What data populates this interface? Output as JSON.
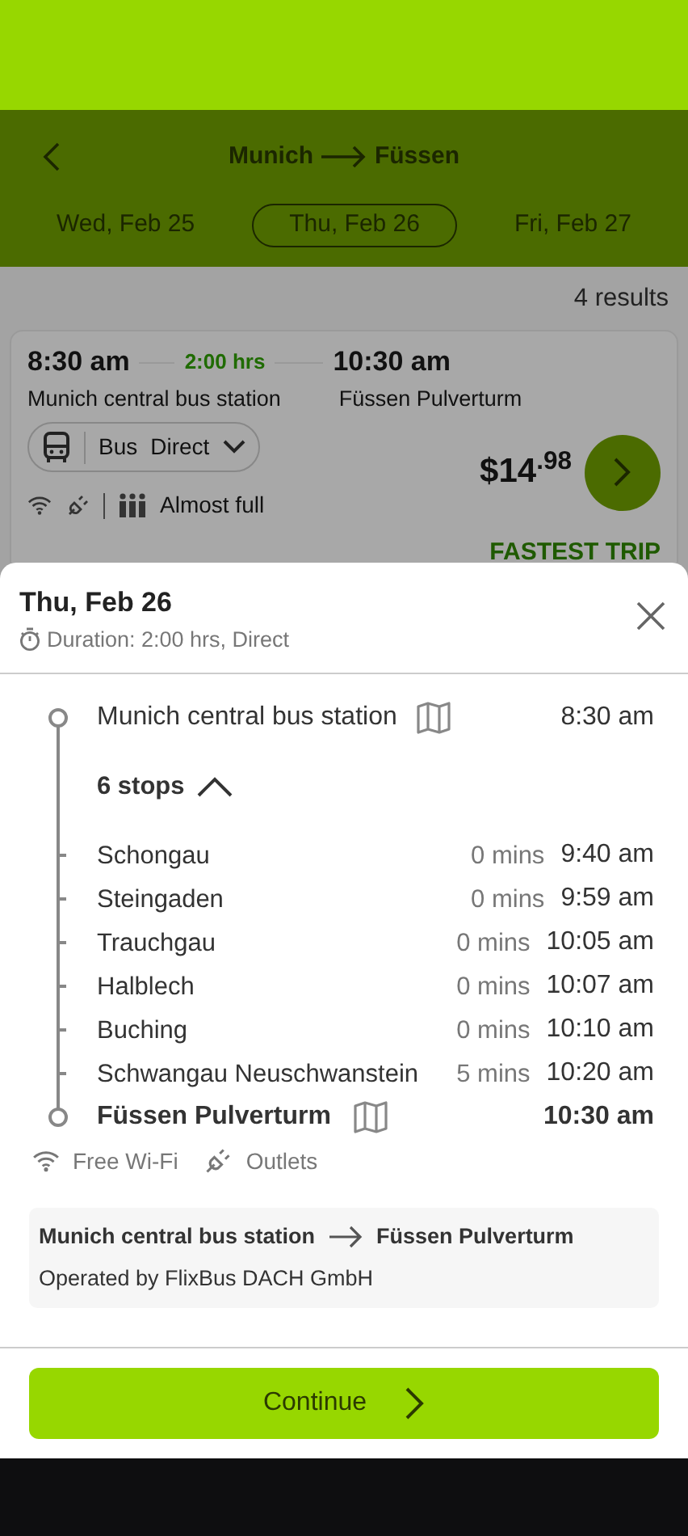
{
  "header": {
    "from": "Munich",
    "to": "Füssen"
  },
  "date_tabs": [
    {
      "label": "Wed, Feb 25",
      "selected": false
    },
    {
      "label": "Thu, Feb 26",
      "selected": true
    },
    {
      "label": "Fri, Feb 27",
      "selected": false
    }
  ],
  "results_count": "4 results",
  "trip_card": {
    "departure_time": "8:30 am",
    "duration": "2:00 hrs",
    "arrival_time": "10:30 am",
    "from": "Munich central bus station",
    "to": "Füssen Pulverturm",
    "mode": "Bus",
    "type": "Direct",
    "price": "$14$^{.98}$",
    "occupancy": "Almost full",
    "badge": "FASTEST TRIP"
  },
  "sheet": {
    "date": "Thu, Feb 26",
    "duration": "Duration: 2:00 hrs, Direct",
    "departure": {
      "name": "Munich central bus station",
      "time": "8:30 am"
    },
    "stops_toggle": {
      "label": "6 stops",
      "expanded": true
    },
    "stops": [
      {
        "name": "Schongau",
        "wait": "0 mins",
        "time": "9:40 am"
      },
      {
        "name": "Steingaden",
        "wait": "0 mins",
        "time": "9:59 am"
      },
      {
        "name": "Trauchgau",
        "wait": "0 mins",
        "time": "10:05 am"
      },
      {
        "name": "Halblech",
        "wait": "0 mins",
        "time": "10:07 am"
      },
      {
        "name": "Buching",
        "wait": "0 mins",
        "time": "10:10 am"
      },
      {
        "name": "Schwangau Neuschwanstein",
        "wait": "5 mins",
        "time": "10:20 am"
      }
    ],
    "arrival": {
      "name": "Füssen Pulverturm",
      "time": "10:30 am"
    },
    "amenities": [
      {
        "kind": "wifi",
        "label": "Free Wi-Fi"
      },
      {
        "kind": "outlet",
        "label": "Outlets"
      }
    ],
    "operator": {
      "from": "Munich central bus station",
      "to": "Füssen Pulverturm",
      "text": "Operated by FlixBus DACH GmbH"
    },
    "button": "Continue"
  }
}
